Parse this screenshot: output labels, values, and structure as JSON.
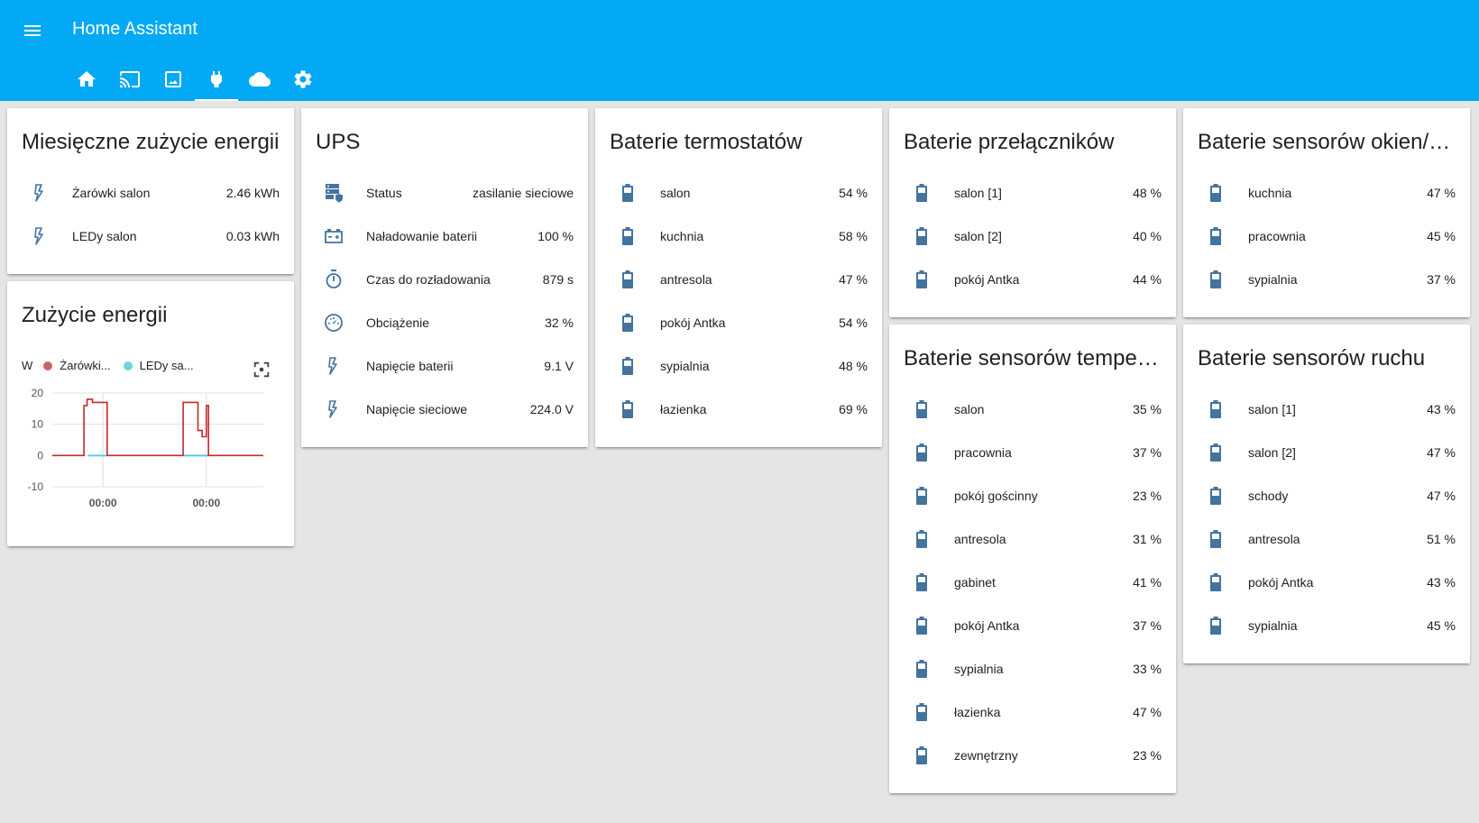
{
  "app": {
    "title": "Home Assistant"
  },
  "colors": {
    "header": "#03a9f4",
    "battery_icon": "#44739e",
    "series1": "#c62828",
    "series2": "#4dd0e1"
  },
  "tabs": [
    {
      "icon": "home-icon",
      "active": false
    },
    {
      "icon": "cast-icon",
      "active": false
    },
    {
      "icon": "image-icon",
      "active": false
    },
    {
      "icon": "power-plug-icon",
      "active": true
    },
    {
      "icon": "cloud-icon",
      "active": false
    },
    {
      "icon": "settings-icon",
      "active": false
    }
  ],
  "energy_card": {
    "title": "Miesięczne zużycie energii",
    "rows": [
      {
        "icon": "flash-icon",
        "name": "Żarówki salon",
        "value": "2.46 kWh"
      },
      {
        "icon": "flash-icon",
        "name": "LEDy salon",
        "value": "0.03 kWh"
      }
    ]
  },
  "graph_card": {
    "title": "Zużycie energii",
    "legend": {
      "unit": "W",
      "items": [
        "Żarówki...",
        "LEDy sa..."
      ]
    },
    "chart_data": {
      "type": "line",
      "title": "Zużycie energii",
      "ylabel": "W",
      "ylim": [
        -10,
        20
      ],
      "yticks": [
        "20",
        "10",
        "0",
        "-10"
      ],
      "xticks": [
        "00:00",
        "00:00"
      ],
      "grid": true,
      "series": [
        {
          "name": "Żarówki...",
          "points": [
            [
              0,
              0
            ],
            [
              0.15,
              0
            ],
            [
              0.15,
              16
            ],
            [
              0.165,
              16
            ],
            [
              0.165,
              18
            ],
            [
              0.19,
              18
            ],
            [
              0.19,
              17
            ],
            [
              0.26,
              17
            ],
            [
              0.26,
              0
            ],
            [
              0.62,
              0
            ],
            [
              0.62,
              17
            ],
            [
              0.69,
              17
            ],
            [
              0.69,
              8
            ],
            [
              0.71,
              8
            ],
            [
              0.71,
              6
            ],
            [
              0.73,
              6
            ],
            [
              0.73,
              16
            ],
            [
              0.74,
              16
            ],
            [
              0.74,
              0
            ],
            [
              1.0,
              0
            ]
          ]
        },
        {
          "name": "LEDy sa...",
          "points": [
            [
              0.17,
              0
            ],
            [
              0.26,
              0
            ],
            [
              0.62,
              0
            ],
            [
              0.74,
              0
            ]
          ]
        }
      ]
    }
  },
  "ups_card": {
    "title": "UPS",
    "rows": [
      {
        "icon": "server-shield-icon",
        "name": "Status",
        "value": "zasilanie sieciowe"
      },
      {
        "icon": "car-battery-icon",
        "name": "Naładowanie baterii",
        "value": "100 %"
      },
      {
        "icon": "timer-icon",
        "name": "Czas do rozładowania",
        "value": "879 s"
      },
      {
        "icon": "gauge-icon",
        "name": "Obciążenie",
        "value": "32 %"
      },
      {
        "icon": "flash-icon",
        "name": "Napięcie baterii",
        "value": "9.1 V"
      },
      {
        "icon": "flash-icon",
        "name": "Napięcie sieciowe",
        "value": "224.0 V"
      }
    ]
  },
  "thermostat_card": {
    "title": "Baterie termostatów",
    "rows": [
      {
        "name": "salon",
        "value": "54 %"
      },
      {
        "name": "kuchnia",
        "value": "58 %"
      },
      {
        "name": "antresola",
        "value": "47 %"
      },
      {
        "name": "pokój Antka",
        "value": "54 %"
      },
      {
        "name": "sypialnia",
        "value": "48 %"
      },
      {
        "name": "łazienka",
        "value": "69 %"
      }
    ]
  },
  "switch_card": {
    "title": "Baterie przełączników",
    "rows": [
      {
        "name": "salon [1]",
        "value": "48 %"
      },
      {
        "name": "salon [2]",
        "value": "40 %"
      },
      {
        "name": "pokój Antka",
        "value": "44 %"
      }
    ]
  },
  "temp_card": {
    "title": "Baterie sensorów temperatury",
    "rows": [
      {
        "name": "salon",
        "value": "35 %"
      },
      {
        "name": "pracownia",
        "value": "37 %"
      },
      {
        "name": "pokój gościnny",
        "value": "23 %"
      },
      {
        "name": "antresola",
        "value": "31 %"
      },
      {
        "name": "gabinet",
        "value": "41 %"
      },
      {
        "name": "pokój Antka",
        "value": "37 %"
      },
      {
        "name": "sypialnia",
        "value": "33 %"
      },
      {
        "name": "łazienka",
        "value": "47 %"
      },
      {
        "name": "zewnętrzny",
        "value": "23 %"
      }
    ]
  },
  "window_card": {
    "title": "Baterie sensorów okien/drzwi",
    "rows": [
      {
        "name": "kuchnia",
        "value": "47 %"
      },
      {
        "name": "pracownia",
        "value": "45 %"
      },
      {
        "name": "sypialnia",
        "value": "37 %"
      }
    ]
  },
  "motion_card": {
    "title": "Baterie sensorów ruchu",
    "rows": [
      {
        "name": "salon [1]",
        "value": "43 %"
      },
      {
        "name": "salon [2]",
        "value": "47 %"
      },
      {
        "name": "schody",
        "value": "47 %"
      },
      {
        "name": "antresola",
        "value": "51 %"
      },
      {
        "name": "pokój Antka",
        "value": "43 %"
      },
      {
        "name": "sypialnia",
        "value": "45 %"
      }
    ]
  }
}
